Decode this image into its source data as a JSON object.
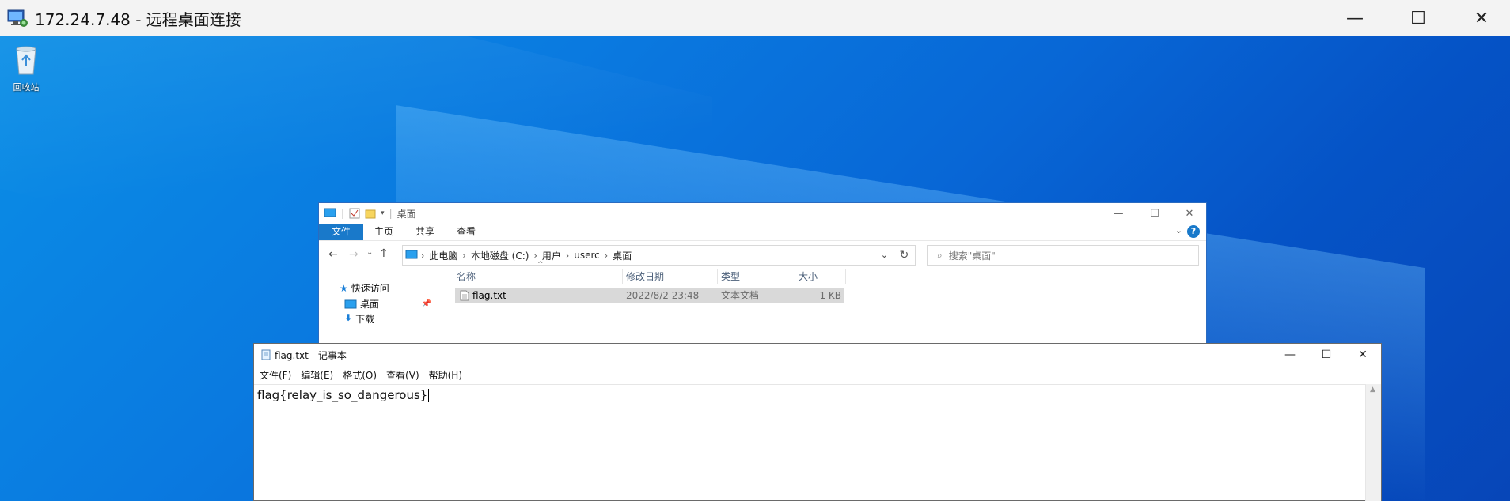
{
  "rdp": {
    "title": "172.24.7.48 - 远程桌面连接",
    "minimize_glyph": "—",
    "maximize_glyph": "☐",
    "close_glyph": "✕"
  },
  "desktop": {
    "recycle_bin_label": "回收站"
  },
  "explorer": {
    "window_title": "桌面",
    "ribbon_tabs": [
      "文件",
      "主页",
      "共享",
      "查看"
    ],
    "address_crumbs": [
      "此电脑",
      "本地磁盘 (C:)",
      "用户",
      "userc",
      "桌面"
    ],
    "search_placeholder": "搜索\"桌面\"",
    "nav_pane": {
      "quick_access": "快速访问",
      "items": [
        "桌面",
        "下载"
      ]
    },
    "columns": [
      "名称",
      "修改日期",
      "类型",
      "大小"
    ],
    "files": [
      {
        "name": "flag.txt",
        "modified": "2022/8/2 23:48",
        "type": "文本文档",
        "size": "1 KB"
      }
    ]
  },
  "notepad": {
    "title": "flag.txt - 记事本",
    "menus": [
      "文件(F)",
      "编辑(E)",
      "格式(O)",
      "查看(V)",
      "帮助(H)"
    ],
    "content": "flag{relay_is_so_dangerous}"
  }
}
